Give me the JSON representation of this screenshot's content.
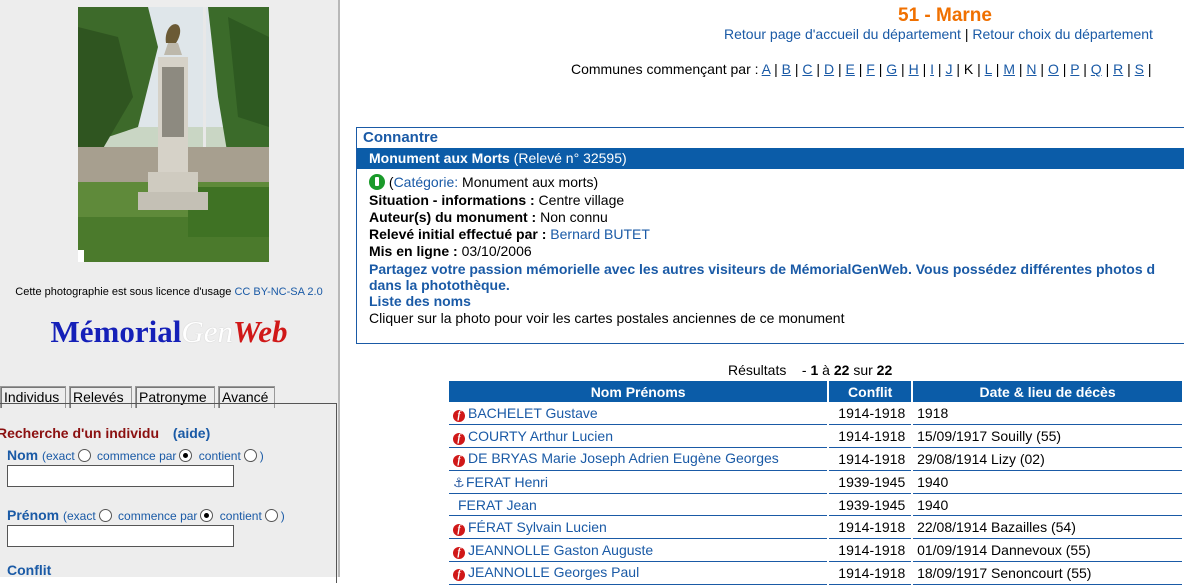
{
  "sidebar": {
    "photo_alt": "Monument aux morts de Connantre",
    "license_text": "Cette photographie est sous licence d'usage",
    "license_link": "CC BY-NC-SA 2.0",
    "logo": {
      "part1": "Mémorial",
      "part2": "Gen",
      "part3": "Web"
    },
    "tabs": [
      "Individus",
      "Relevés",
      "Patronyme",
      "Avancé"
    ],
    "search": {
      "title": "Recherche d'un individu",
      "help": "(aide)",
      "nom_label": "Nom",
      "prenom_label": "Prénom",
      "opt_exact": "(exact",
      "opt_commence": "commence par",
      "opt_contient": "contient",
      "opt_close": ")",
      "nom_value": "",
      "prenom_value": "",
      "conflit_label": "Conflit"
    }
  },
  "header": {
    "department": "51 - Marne",
    "link_home": "Retour page d'accueil du département",
    "separator": "|",
    "link_choice": "Retour choix du département",
    "communes_prefix": "Communes commençant par :",
    "letters": [
      "A",
      "B",
      "C",
      "D",
      "E",
      "F",
      "G",
      "H",
      "I",
      "J",
      "K",
      "L",
      "M",
      "N",
      "O",
      "P",
      "Q",
      "R",
      "S"
    ],
    "current_letter": "K"
  },
  "monument": {
    "commune": "Connantre",
    "bar_title": "Monument aux Morts",
    "bar_releve": "(Relevé n° 32595)",
    "categorie_label": "Catégorie:",
    "categorie_value": "Monument aux morts)",
    "situation_label": "Situation - informations :",
    "situation_value": "Centre village",
    "auteur_label": "Auteur(s) du monument :",
    "auteur_value": "Non connu",
    "releve_label": "Relevé initial effectué par :",
    "releve_value": "Bernard BUTET",
    "en_ligne_label": "Mis en ligne :",
    "en_ligne_value": "03/10/2006",
    "share_line1": "Partagez votre passion mémorielle avec les autres visiteurs de MémorialGenWeb. Vous possédez différentes photos d",
    "share_line2": "dans la photothèque.",
    "liste_noms": "Liste des noms",
    "cartes_text": "Cliquer sur la photo pour voir les cartes postales anciennes de ce monument"
  },
  "results": {
    "prefix": "Résultats",
    "dash": "-",
    "from": "1",
    "a": "à",
    "to": "22",
    "sur": "sur",
    "total": "22",
    "columns": [
      "Nom Prénoms",
      "Conflit",
      "Date & lieu de décès"
    ],
    "rows": [
      {
        "icon": "french-flag-icon",
        "name": "BACHELET Gustave",
        "conflit": "1914-1918",
        "deces": "1918"
      },
      {
        "icon": "french-flag-icon",
        "name": "COURTY Arthur Lucien",
        "conflit": "1914-1918",
        "deces": "15/09/1917 Souilly (55)"
      },
      {
        "icon": "french-flag-icon",
        "name": "DE BRYAS Marie Joseph Adrien Eugène Georges",
        "conflit": "1914-1918",
        "deces": "29/08/1914 Lizy (02)"
      },
      {
        "icon": "anchor-icon",
        "name": "FERAT Henri",
        "conflit": "1939-1945",
        "deces": "1940"
      },
      {
        "icon": "none",
        "name": "FERAT Jean",
        "conflit": "1939-1945",
        "deces": "1940"
      },
      {
        "icon": "french-flag-icon",
        "name": "FÉRAT Sylvain Lucien",
        "conflit": "1914-1918",
        "deces": "22/08/1914 Bazailles (54)"
      },
      {
        "icon": "french-flag-icon",
        "name": "JEANNOLLE Gaston Auguste",
        "conflit": "1914-1918",
        "deces": "01/09/1914 Dannevoux (55)"
      },
      {
        "icon": "french-flag-icon",
        "name": "JEANNOLLE Georges Paul",
        "conflit": "1914-1918",
        "deces": "18/09/1917 Senoncourt (55)"
      }
    ]
  }
}
